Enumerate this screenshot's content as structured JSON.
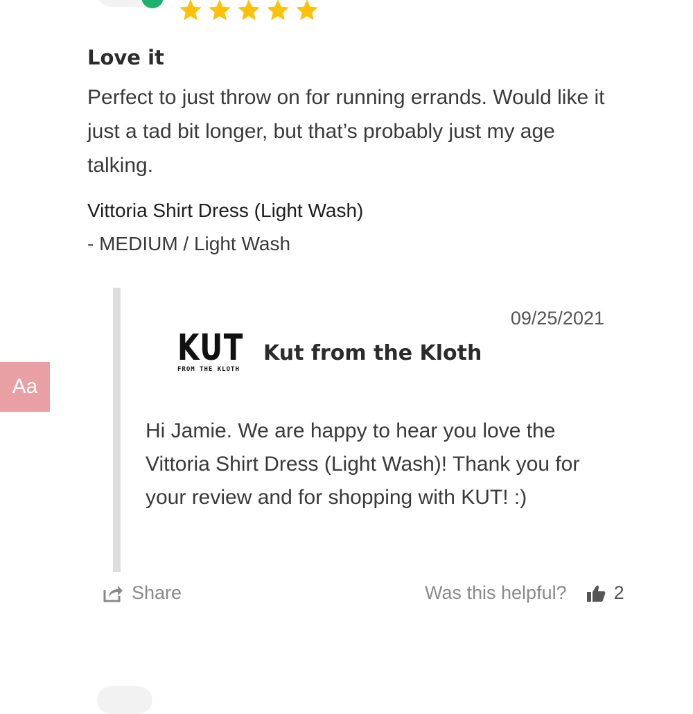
{
  "review": {
    "rating": 5,
    "max_rating": 5,
    "title": "Love it",
    "body": "Perfect to just throw on for running errands. Would like it just a tad bit longer, but that’s probably just my age talking.",
    "product_name": "Vittoria Shirt Dress (Light Wash)",
    "product_variant": "- MEDIUM / Light Wash"
  },
  "reply": {
    "date": "09/25/2021",
    "logo_main": "KUT",
    "logo_sub": "FROM THE KLOTH",
    "brand_name": "Kut from the Kloth",
    "body": "Hi Jamie. We are happy to hear you love the Vittoria Shirt Dress (Light Wash)! Thank you for your review and for shopping with KUT! :)"
  },
  "footer": {
    "share_label": "Share",
    "helpful_label": "Was this helpful?",
    "helpful_count": "2"
  },
  "accessibility": {
    "font_button_label": "Aa"
  },
  "icons": {
    "star": "star-icon",
    "share": "share-icon",
    "thumbs": "thumbs-up-icon",
    "verified": "verified-badge-icon"
  },
  "colors": {
    "star": "#ffc107",
    "verified": "#1db26b",
    "font_button": "#e8a0a4",
    "reply_bar": "#dddddd",
    "muted_text": "#8a8a8a"
  }
}
